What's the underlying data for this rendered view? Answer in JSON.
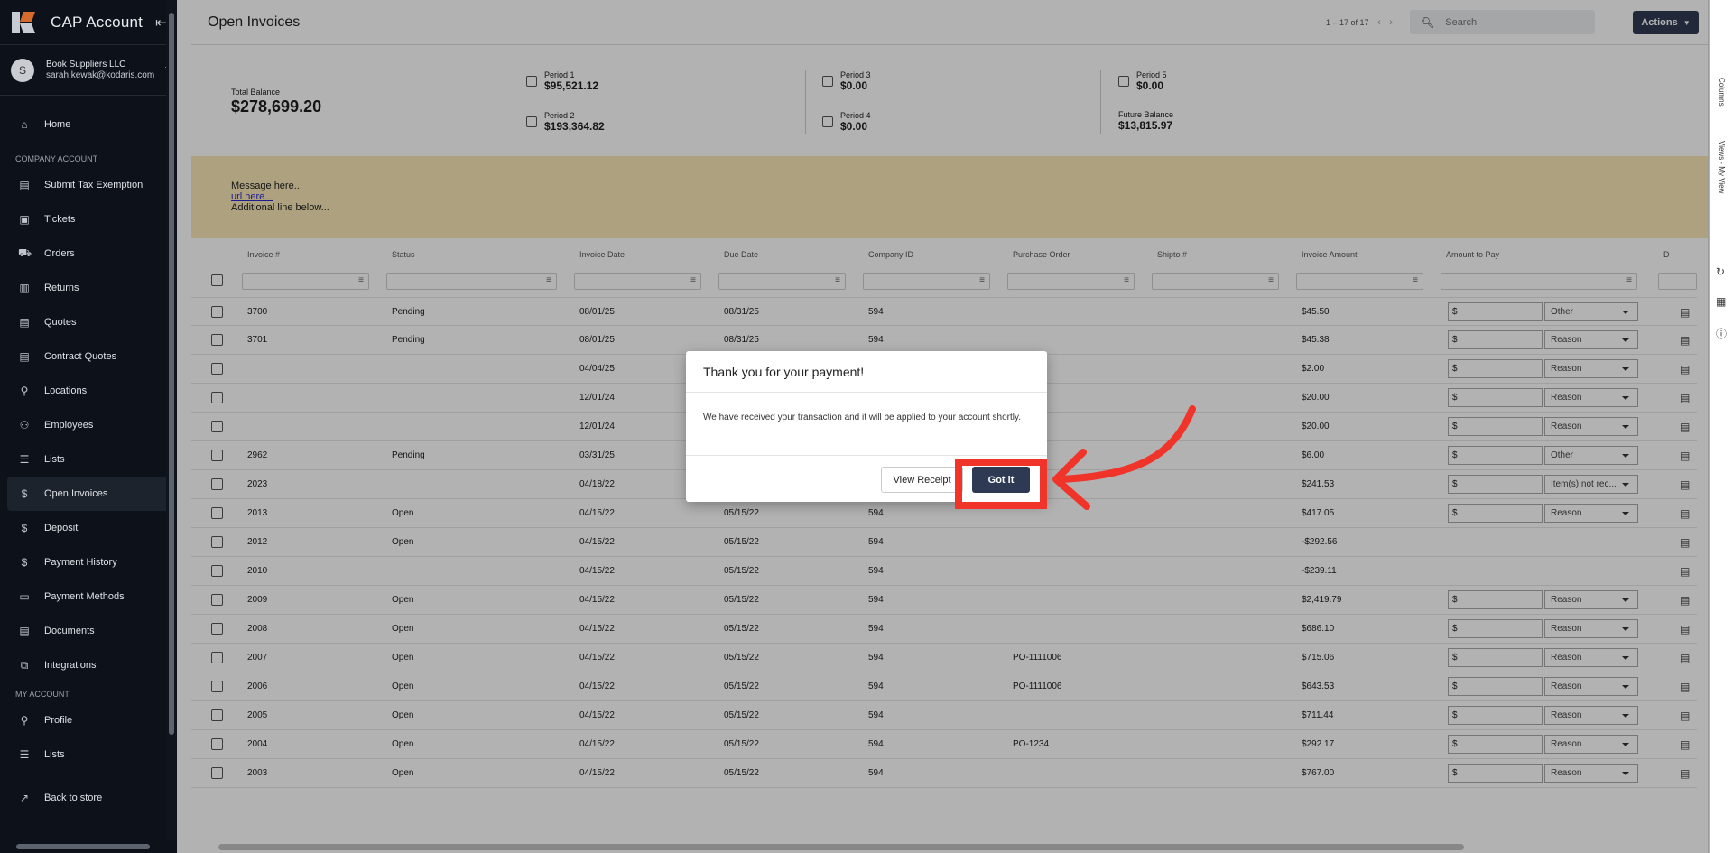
{
  "app": {
    "title": "CAP Account"
  },
  "user": {
    "initial": "S",
    "company": "Book Suppliers LLC",
    "email": "sarah.kewak@kodaris.com"
  },
  "sidebar": {
    "home": "Home",
    "section_company": "COMPANY ACCOUNT",
    "company_items": [
      {
        "label": "Submit Tax Exemption",
        "icon": "document-icon"
      },
      {
        "label": "Tickets",
        "icon": "ticket-icon"
      },
      {
        "label": "Orders",
        "icon": "truck-icon"
      },
      {
        "label": "Returns",
        "icon": "returns-icon"
      },
      {
        "label": "Quotes",
        "icon": "clipboard-icon"
      },
      {
        "label": "Contract Quotes",
        "icon": "clipboard-icon"
      },
      {
        "label": "Locations",
        "icon": "location-pin-icon"
      },
      {
        "label": "Employees",
        "icon": "people-icon"
      },
      {
        "label": "Lists",
        "icon": "list-icon"
      },
      {
        "label": "Open Invoices",
        "icon": "dollar-icon"
      },
      {
        "label": "Deposit",
        "icon": "dollar-icon"
      },
      {
        "label": "Payment History",
        "icon": "dollar-icon"
      },
      {
        "label": "Payment Methods",
        "icon": "credit-card-icon"
      },
      {
        "label": "Documents",
        "icon": "document-icon"
      },
      {
        "label": "Integrations",
        "icon": "integrations-icon"
      }
    ],
    "section_my": "MY ACCOUNT",
    "my_items": [
      {
        "label": "Profile",
        "icon": "person-icon"
      },
      {
        "label": "Lists",
        "icon": "list-icon"
      }
    ],
    "back": "Back to store"
  },
  "header": {
    "title": "Open Invoices",
    "pager": "1 – 17 of 17",
    "search_placeholder": "Search",
    "actions": "Actions"
  },
  "balances": {
    "total_label": "Total Balance",
    "total_value": "$278,699.20",
    "p1_label": "Period 1",
    "p1_value": "$95,521.12",
    "p2_label": "Period 2",
    "p2_value": "$193,364.82",
    "p3_label": "Period 3",
    "p3_value": "$0.00",
    "p4_label": "Period 4",
    "p4_value": "$0.00",
    "p5_label": "Period 5",
    "p5_value": "$0.00",
    "future_label": "Future Balance",
    "future_value": "$13,815.97"
  },
  "message": {
    "line1": "Message here...",
    "url": "url here...",
    "line3": "Additional line below..."
  },
  "table": {
    "columns": [
      "Invoice #",
      "Status",
      "Invoice Date",
      "Due Date",
      "Company ID",
      "Purchase Order",
      "Shipto #",
      "Invoice Amount",
      "Amount to Pay",
      "D"
    ],
    "rows": [
      {
        "inv": "3700",
        "status": "Pending",
        "idate": "08/01/25",
        "due": "08/31/25",
        "cid": "594",
        "po": "",
        "amount": "$45.50",
        "pay": "$",
        "reason": "Other"
      },
      {
        "inv": "3701",
        "status": "Pending",
        "idate": "08/01/25",
        "due": "08/31/25",
        "cid": "594",
        "po": "",
        "amount": "$45.38",
        "pay": "$",
        "reason": "Reason"
      },
      {
        "inv": "",
        "status": "",
        "idate": "04/04/25",
        "due": "",
        "cid": "",
        "po": "",
        "amount": "$2.00",
        "pay": "$",
        "reason": "Reason"
      },
      {
        "inv": "",
        "status": "",
        "idate": "12/01/24",
        "due": "",
        "cid": "",
        "po": "",
        "amount": "$20.00",
        "pay": "$",
        "reason": "Reason"
      },
      {
        "inv": "",
        "status": "",
        "idate": "12/01/24",
        "due": "",
        "cid": "",
        "po": "",
        "amount": "$20.00",
        "pay": "$",
        "reason": "Reason"
      },
      {
        "inv": "2962",
        "status": "Pending",
        "idate": "03/31/25",
        "due": "",
        "cid": "",
        "po": "",
        "amount": "$6.00",
        "pay": "$",
        "reason": "Other"
      },
      {
        "inv": "2023",
        "status": "",
        "idate": "04/18/22",
        "due": "",
        "cid": "",
        "po": "",
        "amount": "$241.53",
        "pay": "$",
        "reason": "Item(s) not rec..."
      },
      {
        "inv": "2013",
        "status": "Open",
        "idate": "04/15/22",
        "due": "05/15/22",
        "cid": "594",
        "po": "",
        "amount": "$417.05",
        "pay": "$",
        "reason": "Reason"
      },
      {
        "inv": "2012",
        "status": "Open",
        "idate": "04/15/22",
        "due": "05/15/22",
        "cid": "594",
        "po": "",
        "amount": "-$292.56",
        "pay": null,
        "reason": null
      },
      {
        "inv": "2010",
        "status": "",
        "idate": "04/15/22",
        "due": "05/15/22",
        "cid": "594",
        "po": "",
        "amount": "-$239.11",
        "pay": null,
        "reason": null
      },
      {
        "inv": "2009",
        "status": "Open",
        "idate": "04/15/22",
        "due": "05/15/22",
        "cid": "594",
        "po": "",
        "amount": "$2,419.79",
        "pay": "$",
        "reason": "Reason"
      },
      {
        "inv": "2008",
        "status": "Open",
        "idate": "04/15/22",
        "due": "05/15/22",
        "cid": "594",
        "po": "",
        "amount": "$686.10",
        "pay": "$",
        "reason": "Reason"
      },
      {
        "inv": "2007",
        "status": "Open",
        "idate": "04/15/22",
        "due": "05/15/22",
        "cid": "594",
        "po": "PO-1111006",
        "amount": "$715.06",
        "pay": "$",
        "reason": "Reason"
      },
      {
        "inv": "2006",
        "status": "Open",
        "idate": "04/15/22",
        "due": "05/15/22",
        "cid": "594",
        "po": "PO-1111006",
        "amount": "$643.53",
        "pay": "$",
        "reason": "Reason"
      },
      {
        "inv": "2005",
        "status": "Open",
        "idate": "04/15/22",
        "due": "05/15/22",
        "cid": "594",
        "po": "",
        "amount": "$711.44",
        "pay": "$",
        "reason": "Reason"
      },
      {
        "inv": "2004",
        "status": "Open",
        "idate": "04/15/22",
        "due": "05/15/22",
        "cid": "594",
        "po": "PO-1234",
        "amount": "$292.17",
        "pay": "$",
        "reason": "Reason"
      },
      {
        "inv": "2003",
        "status": "Open",
        "idate": "04/15/22",
        "due": "05/15/22",
        "cid": "594",
        "po": "",
        "amount": "$767.00",
        "pay": "$",
        "reason": "Reason"
      }
    ]
  },
  "rightrail": {
    "columns": "Columns",
    "views": "Views - My View"
  },
  "modal": {
    "title": "Thank you for your payment!",
    "body": "We have received your transaction and it will be applied to your account shortly.",
    "view_receipt": "View Receipt",
    "got_it": "Got it"
  },
  "colors": {
    "accent": "#2e3a53",
    "highlight": "#f0342a",
    "message_bg": "#f8e7b7",
    "sidebar_bg": "#0c111a"
  }
}
